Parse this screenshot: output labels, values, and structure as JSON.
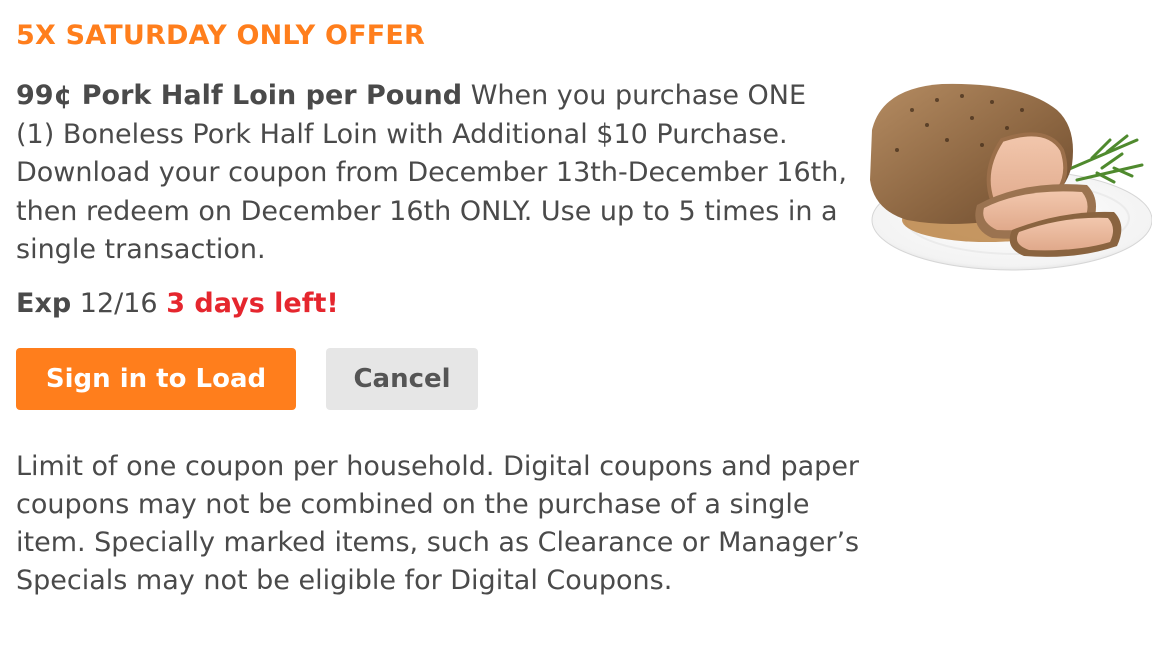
{
  "offer": {
    "title": "5X SATURDAY ONLY OFFER",
    "headline": "99¢ Pork Half Loin per Pound",
    "description": "When you purchase ONE (1) Boneless Pork Half Loin with Additional $10 Purchase. Download your coupon from December 13th-December 16th, then redeem on December 16th ONLY. Use up to 5 times in a single transaction.",
    "image_subject": "sliced roasted pork loin with rosemary on plate"
  },
  "expiry": {
    "label": "Exp",
    "date": "12/16",
    "days_left": "3 days left!"
  },
  "actions": {
    "sign_in_label": "Sign in to Load",
    "cancel_label": "Cancel"
  },
  "terms": {
    "text": "Limit of one coupon per household. Digital coupons and paper coupons may not be combined on the purchase of a single item. Specially marked items, such as Clearance or Manager’s Specials may not be eligible for Digital Coupons."
  },
  "colors": {
    "accent": "#ff7e1c",
    "urgent": "#e5262e",
    "body_text": "#4a4a4a",
    "secondary_button": "#e6e6e6"
  }
}
